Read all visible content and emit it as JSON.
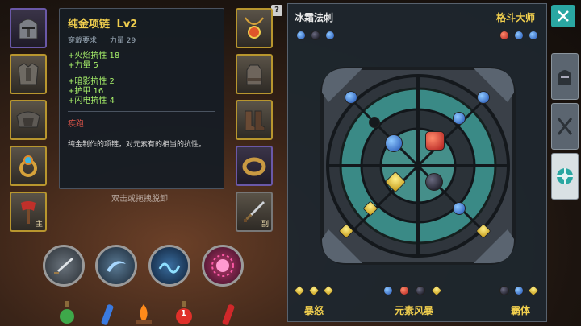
{
  "equipment_left": [
    {
      "name": "helmet"
    },
    {
      "name": "chest-armor"
    },
    {
      "name": "shoulder-armor"
    },
    {
      "name": "ring"
    },
    {
      "name": "weapon",
      "tag": "主"
    }
  ],
  "equipment_right": [
    {
      "name": "necklace"
    },
    {
      "name": "gloves"
    },
    {
      "name": "boots"
    },
    {
      "name": "bracelet"
    },
    {
      "name": "offhand-sword",
      "tag": "副"
    }
  ],
  "help_badge": "?",
  "tooltip": {
    "title": "纯金项链",
    "level": "Lv2",
    "req_label": "穿戴要求:",
    "req_value": "力量 29",
    "stats_a": [
      "+火焰抗性 18",
      "+力量 5"
    ],
    "stats_b": [
      "+暗影抗性 2",
      "+护甲 16",
      "+闪电抗性 4"
    ],
    "tag": "疾跑",
    "description": "纯金制作的项链，对元素有的相当的抗性。"
  },
  "hint_text": "双击或拖拽脱卸",
  "skills": [
    "slash-skill",
    "whirl-skill",
    "wave-skill",
    "burst-skill"
  ],
  "potions": [
    "green-potion",
    "blue-vial",
    "campfire",
    "red-potion",
    "red-vial"
  ],
  "potion_count": "1",
  "panel": {
    "top_left_title": "冰霜法刺",
    "top_left_gems": [
      "blue",
      "black",
      "blue"
    ],
    "top_right_title": "格斗大师",
    "top_right_gems": [
      "red",
      "blue",
      "blue"
    ],
    "bottom": [
      {
        "label": "暴怒",
        "gems": [
          "gold",
          "gold",
          "gold"
        ],
        "color": "#f1cf4e"
      },
      {
        "label": "元素风暴",
        "gems": [
          "blue",
          "red",
          "black",
          "gold"
        ],
        "color": "#f1cf4e"
      },
      {
        "label": "霸体",
        "gems": [
          "black",
          "blue",
          "gold"
        ],
        "color": "#f1cf4e"
      }
    ]
  },
  "side_tabs": [
    "helmet-tab",
    "weapons-tab",
    "rune-tab"
  ],
  "colors": {
    "accent_gold": "#f1cf4e",
    "stat_green": "#a7f06a",
    "tag_red": "#e0554a",
    "teal": "#2aa7a2"
  }
}
